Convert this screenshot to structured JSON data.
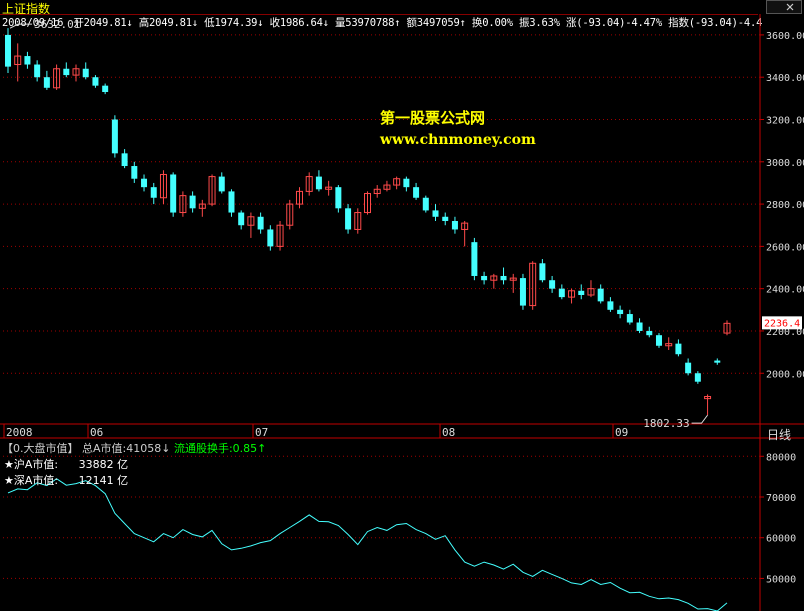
{
  "window": {
    "title": "上证指数"
  },
  "infobar": {
    "date": "2008/09/16",
    "open": "开2049.81↓",
    "high": "高2049.81↓",
    "low": "低1974.39↓",
    "close": "收1986.64↓",
    "volume": "量53970788↑",
    "amount": "额3497059↑",
    "turnover": "换0.00%",
    "amplitude": "振3.63%",
    "change": "涨(-93.04)-4.47%",
    "index": "指数(-93.04)-4.4"
  },
  "watermark": {
    "line1": "第一股票公式网",
    "line2": "www.chnmoney.com"
  },
  "period": {
    "label": "日线"
  },
  "lower": {
    "indicator": "【0.大盘市值】",
    "total_label": "总A市值:",
    "total_value": "41058↓",
    "turnover_label": "流通股换手:",
    "turnover_value": "0.85↑",
    "sh_label": "★沪A市值:",
    "sh_value": "33882",
    "sh_unit": "亿",
    "sz_label": "★深A市值:",
    "sz_value": "12141",
    "sz_unit": "亿"
  },
  "colors": {
    "up": "#ff4a4a",
    "down": "#4ff",
    "grid": "#a00000",
    "axis": "#c00000"
  },
  "chart_data": [
    {
      "type": "candlestick",
      "title": "上证指数",
      "y_ticks": [
        2000,
        2200,
        2400,
        2600,
        2800,
        3000,
        3200,
        3400,
        3600
      ],
      "ylim": [
        1760,
        3680
      ],
      "x_labels": [
        "2008",
        "06",
        "07",
        "08",
        "09"
      ],
      "annotations": {
        "high": "3632.01",
        "low": "1802.33",
        "last": "2236.4"
      },
      "candles": [
        [
          3600,
          3632,
          3420,
          3450
        ],
        [
          3460,
          3560,
          3380,
          3500
        ],
        [
          3500,
          3520,
          3440,
          3460
        ],
        [
          3460,
          3480,
          3380,
          3400
        ],
        [
          3400,
          3430,
          3340,
          3350
        ],
        [
          3350,
          3460,
          3340,
          3440
        ],
        [
          3440,
          3470,
          3400,
          3410
        ],
        [
          3410,
          3460,
          3380,
          3440
        ],
        [
          3440,
          3470,
          3390,
          3400
        ],
        [
          3400,
          3410,
          3350,
          3360
        ],
        [
          3360,
          3370,
          3320,
          3330
        ],
        [
          3200,
          3220,
          3020,
          3040
        ],
        [
          3040,
          3060,
          2970,
          2980
        ],
        [
          2980,
          3000,
          2900,
          2920
        ],
        [
          2920,
          2940,
          2860,
          2880
        ],
        [
          2880,
          2900,
          2800,
          2830
        ],
        [
          2830,
          2960,
          2800,
          2940
        ],
        [
          2940,
          2950,
          2740,
          2760
        ],
        [
          2760,
          2860,
          2740,
          2840
        ],
        [
          2840,
          2860,
          2760,
          2780
        ],
        [
          2780,
          2820,
          2740,
          2800
        ],
        [
          2800,
          2940,
          2790,
          2930
        ],
        [
          2930,
          2950,
          2850,
          2860
        ],
        [
          2860,
          2870,
          2740,
          2760
        ],
        [
          2760,
          2770,
          2680,
          2700
        ],
        [
          2700,
          2760,
          2640,
          2740
        ],
        [
          2740,
          2760,
          2660,
          2680
        ],
        [
          2680,
          2700,
          2580,
          2600
        ],
        [
          2600,
          2720,
          2580,
          2700
        ],
        [
          2700,
          2820,
          2680,
          2800
        ],
        [
          2800,
          2880,
          2780,
          2860
        ],
        [
          2860,
          2950,
          2840,
          2930
        ],
        [
          2930,
          2960,
          2860,
          2870
        ],
        [
          2870,
          2910,
          2840,
          2880
        ],
        [
          2880,
          2890,
          2760,
          2780
        ],
        [
          2780,
          2800,
          2660,
          2680
        ],
        [
          2680,
          2780,
          2660,
          2760
        ],
        [
          2760,
          2860,
          2750,
          2850
        ],
        [
          2850,
          2890,
          2830,
          2870
        ],
        [
          2870,
          2910,
          2860,
          2890
        ],
        [
          2890,
          2930,
          2870,
          2920
        ],
        [
          2920,
          2930,
          2860,
          2880
        ],
        [
          2880,
          2900,
          2820,
          2830
        ],
        [
          2830,
          2840,
          2760,
          2770
        ],
        [
          2770,
          2800,
          2720,
          2740
        ],
        [
          2740,
          2760,
          2700,
          2720
        ],
        [
          2720,
          2740,
          2660,
          2680
        ],
        [
          2680,
          2720,
          2600,
          2710
        ],
        [
          2620,
          2640,
          2440,
          2460
        ],
        [
          2460,
          2480,
          2420,
          2440
        ],
        [
          2440,
          2470,
          2400,
          2460
        ],
        [
          2460,
          2500,
          2420,
          2440
        ],
        [
          2440,
          2470,
          2380,
          2450
        ],
        [
          2450,
          2470,
          2300,
          2320
        ],
        [
          2320,
          2530,
          2300,
          2520
        ],
        [
          2520,
          2540,
          2430,
          2440
        ],
        [
          2440,
          2460,
          2380,
          2400
        ],
        [
          2400,
          2420,
          2350,
          2360
        ],
        [
          2360,
          2400,
          2330,
          2390
        ],
        [
          2390,
          2420,
          2350,
          2370
        ],
        [
          2370,
          2440,
          2360,
          2400
        ],
        [
          2400,
          2420,
          2330,
          2340
        ],
        [
          2340,
          2360,
          2290,
          2300
        ],
        [
          2300,
          2320,
          2260,
          2280
        ],
        [
          2280,
          2300,
          2230,
          2240
        ],
        [
          2240,
          2260,
          2190,
          2200
        ],
        [
          2200,
          2220,
          2170,
          2180
        ],
        [
          2180,
          2190,
          2120,
          2130
        ],
        [
          2130,
          2170,
          2110,
          2140
        ],
        [
          2140,
          2160,
          2080,
          2090
        ],
        [
          2050,
          2070,
          1990,
          2000
        ],
        [
          2000,
          2010,
          1950,
          1960
        ],
        [
          1880,
          1900,
          1802,
          1890
        ],
        [
          2060,
          2070,
          2040,
          2050
        ],
        [
          2190,
          2250,
          2180,
          2236
        ]
      ]
    },
    {
      "type": "line",
      "title": "大盘市值",
      "y_ticks": [
        50000,
        60000,
        70000,
        80000
      ],
      "ylim": [
        42000,
        84000
      ],
      "series": [
        {
          "name": "总A市值",
          "values": [
            71000,
            72000,
            71800,
            73500,
            72800,
            74500,
            72900,
            73300,
            74000,
            72800,
            70800,
            66000,
            63500,
            61000,
            60000,
            59000,
            61000,
            60000,
            62000,
            60800,
            60200,
            61800,
            58500,
            57000,
            57400,
            58000,
            58800,
            59300,
            61000,
            62500,
            64000,
            65600,
            64000,
            63900,
            63000,
            60800,
            58300,
            61500,
            62500,
            61800,
            63200,
            63500,
            62000,
            61000,
            59600,
            60500,
            57000,
            54000,
            53000,
            54000,
            53300,
            52300,
            53500,
            51500,
            50500,
            52000,
            51000,
            50000,
            48900,
            48500,
            49700,
            48500,
            49000,
            47600,
            46500,
            46600,
            45600,
            45000,
            45200,
            44800,
            43900,
            42500,
            42600,
            42000,
            44000
          ]
        }
      ]
    }
  ]
}
